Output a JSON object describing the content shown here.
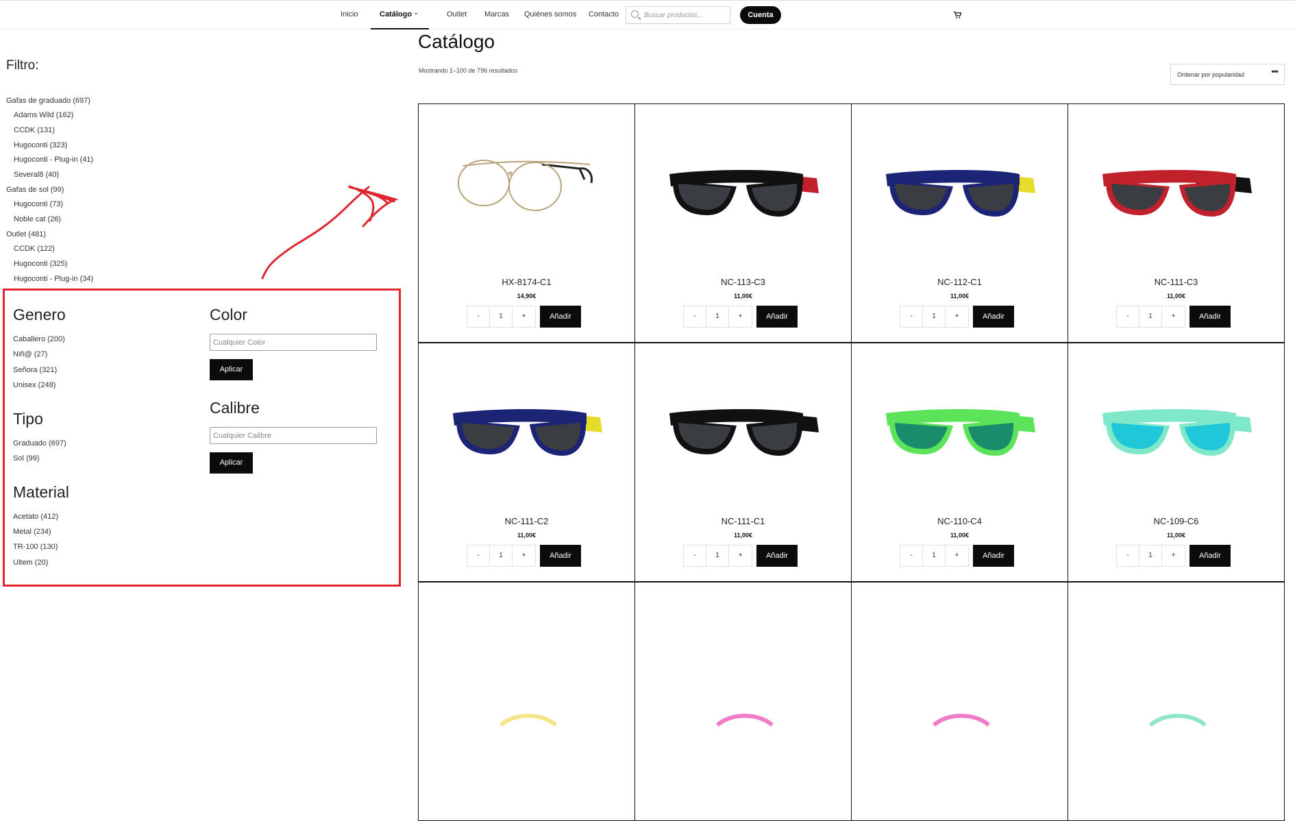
{
  "nav": {
    "items": [
      "Inicio",
      "Catálogo",
      "Outlet",
      "Marcas",
      "Quiénes somos",
      "Contacto"
    ],
    "search_placeholder": "Buscar productos…",
    "account_label": "Cuenta",
    "cart_icon": "cart-icon"
  },
  "sidebar": {
    "title": "Filtro:",
    "categories": [
      {
        "label": "Gafas de graduado (697)"
      },
      {
        "label": "Adams Wild (162)"
      },
      {
        "label": "CCDK (131)"
      },
      {
        "label": "Hugoconti (323)"
      },
      {
        "label": "Hugoconti - Plug-in (41)"
      },
      {
        "label": "Several8 (40)"
      },
      {
        "label": "Gafas de sol (99)"
      },
      {
        "label": "Hugoconti (73)"
      },
      {
        "label": "Noble cat (26)"
      },
      {
        "label": "Outlet (481)"
      },
      {
        "label": "CCDK (122)"
      },
      {
        "label": "Hugoconti (325)"
      },
      {
        "label": "Hugoconti - Plug-in (34)"
      }
    ],
    "genero": {
      "title": "Genero",
      "items": [
        "Caballero (200)",
        "Niñ@ (27)",
        "Señora (321)",
        "Unisex (248)"
      ]
    },
    "tipo": {
      "title": "Tipo",
      "items": [
        "Graduado (697)",
        "Sol (99)"
      ]
    },
    "material": {
      "title": "Material",
      "items": [
        "Acetato (412)",
        "Metal (234)",
        "TR-100 (130)",
        "Ultem (20)"
      ]
    },
    "color": {
      "title": "Color",
      "placeholder": "Cualquier Color",
      "apply": "Aplicar"
    },
    "calibre": {
      "title": "Calibre",
      "placeholder": "Cualquier Calibre",
      "apply": "Aplicar"
    }
  },
  "annotation": {
    "highlight_color": "#e0262f"
  },
  "main": {
    "title": "Catálogo",
    "results": "Mostrando 1–100 de 796 resultados",
    "sort_label": "Ordenar por popularidad",
    "sort_icon": "more-dots-icon"
  },
  "products": [
    {
      "name": "HX-8174-C1",
      "price": "14,90€",
      "qty": "1",
      "add": "Añadir",
      "kind": "optical"
    },
    {
      "name": "NC-113-C3",
      "price": "11,00€",
      "qty": "1",
      "add": "Añadir",
      "kind": "sun",
      "frame": "#111111",
      "temple": "#c0212b",
      "lens": "#3a3d42"
    },
    {
      "name": "NC-112-C1",
      "price": "11,00€",
      "qty": "1",
      "add": "Añadir",
      "kind": "sun",
      "frame": "#1c2475",
      "temple": "#e6dc2a",
      "lens": "#3a3d42"
    },
    {
      "name": "NC-111-C3",
      "price": "11,00€",
      "qty": "1",
      "add": "Añadir",
      "kind": "sun",
      "frame": "#c0212b",
      "temple": "#111111",
      "lens": "#3a3d42"
    },
    {
      "name": "NC-111-C2",
      "price": "11,00€",
      "qty": "1",
      "add": "Añadir",
      "kind": "sun",
      "frame": "#1c2475",
      "temple": "#e6dc2a",
      "lens": "#3a3d42"
    },
    {
      "name": "NC-111-C1",
      "price": "11,00€",
      "qty": "1",
      "add": "Añadir",
      "kind": "sun",
      "frame": "#111111",
      "temple": "#111111",
      "lens": "#3a3d42"
    },
    {
      "name": "NC-110-C4",
      "price": "11,00€",
      "qty": "1",
      "add": "Añadir",
      "kind": "sun",
      "frame": "#5be35a",
      "temple": "#5be35a",
      "lens": "#1a8c6c"
    },
    {
      "name": "NC-109-C6",
      "price": "11,00€",
      "qty": "1",
      "add": "Añadir",
      "kind": "sun",
      "frame": "#7fe8c9",
      "temple": "#7fe8c9",
      "lens": "#1fc7d8"
    },
    {
      "name": "",
      "price": "",
      "qty": "",
      "add": "",
      "kind": "partial",
      "frame": "#f3e58a"
    },
    {
      "name": "",
      "price": "",
      "qty": "",
      "add": "",
      "kind": "partial",
      "frame": "#f07bc8"
    },
    {
      "name": "",
      "price": "",
      "qty": "",
      "add": "",
      "kind": "partial",
      "frame": "#f07bc8"
    },
    {
      "name": "",
      "price": "",
      "qty": "",
      "add": "",
      "kind": "partial",
      "frame": "#8fe6c4"
    }
  ]
}
